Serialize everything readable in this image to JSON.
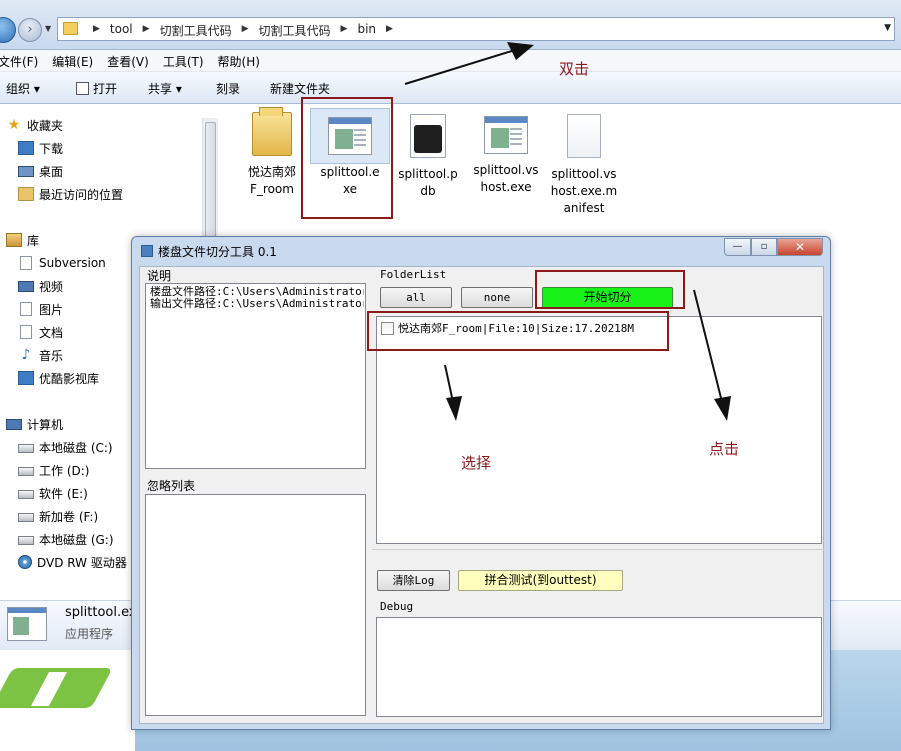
{
  "explorer": {
    "breadcrumb": [
      "tool",
      "切割工具代码",
      "切割工具代码",
      "bin"
    ],
    "menu": [
      "文件(F)",
      "编辑(E)",
      "查看(V)",
      "工具(T)",
      "帮助(H)"
    ],
    "toolbar": {
      "organize": "组织 ▾",
      "open": "打开",
      "share": "共享 ▾",
      "burn": "刻录",
      "new_folder": "新建文件夹"
    },
    "nav": {
      "favorites": "收藏夹",
      "downloads": "下载",
      "desktop": "桌面",
      "recent": "最近访问的位置",
      "libraries": "库",
      "subversion": "Subversion",
      "videos": "视频",
      "pictures": "图片",
      "documents": "文档",
      "music": "音乐",
      "youku": "优酷影视库",
      "computer": "计算机",
      "drive_c": "本地磁盘 (C:)",
      "drive_d": "工作 (D:)",
      "drive_e": "软件 (E:)",
      "drive_f": "新加卷 (F:)",
      "drive_g": "本地磁盘 (G:)",
      "dvd": "DVD RW 驱动器"
    },
    "files": [
      {
        "name": "悦达南郊F_room",
        "icon": "folder-icon"
      },
      {
        "name": "splittool.exe",
        "icon": "app-icon"
      },
      {
        "name": "splittool.pdb",
        "icon": "pdb-file-icon"
      },
      {
        "name": "splittool.vshost.exe",
        "icon": "app-icon"
      },
      {
        "name": "splittool.vshost.exe.manifest",
        "icon": "document-icon"
      }
    ],
    "file_labels": {
      "f0a": "悦达南郊",
      "f0b": "F_room",
      "f1a": "splittool.e",
      "f1b": "xe",
      "f2a": "splittool.p",
      "f2b": "db",
      "f3a": "splittool.vs",
      "f3b": "host.exe",
      "f4a": "splittool.vs",
      "f4b": "host.exe.m",
      "f4c": "anifest"
    },
    "details": {
      "name": "splittool.exe",
      "type": "应用程序"
    }
  },
  "dialog": {
    "title": "楼盘文件切分工具 0.1",
    "desc_label": "说明",
    "desc_lines": [
      "楼盘文件路径:C:\\Users\\Administrator\\",
      "输出文件路径:C:\\Users\\Administrator\\"
    ],
    "ignore_label": "忽略列表",
    "folderlist_label": "FolderList",
    "btn_all": "all",
    "btn_none": "none",
    "btn_start": "开始切分",
    "folder_item": "悦达南郊F_room|File:10|Size:17.20218M",
    "btn_clear_log": "清除Log",
    "btn_merge_test": "拼合测试(到outtest)",
    "debug_label": "Debug",
    "colors": {
      "start_button": "#19f219",
      "merge_button": "#fefebe"
    }
  },
  "annotations": {
    "double_click": "双击",
    "select": "选择",
    "click": "点击",
    "color": "#8b1a1a"
  }
}
